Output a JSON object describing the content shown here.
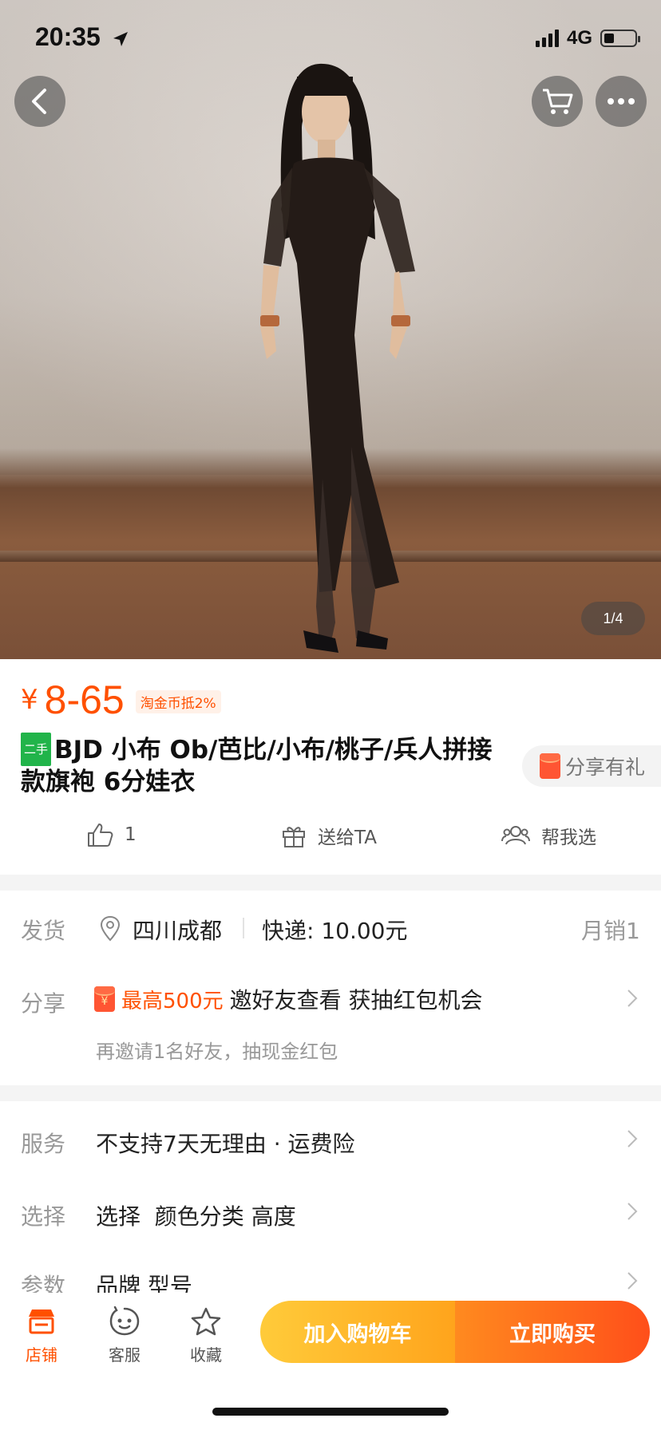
{
  "status_bar": {
    "time": "20:35",
    "network": "4G"
  },
  "gallery": {
    "page_indicator": "1/4"
  },
  "icons": {
    "back": "chevron-left-icon",
    "cart": "cart-icon",
    "more": "more-dots-icon",
    "location": "location-pin-icon",
    "like": "thumbs-up-icon",
    "gift": "gift-icon",
    "help": "people-icon",
    "store": "store-icon",
    "service": "chat-face-icon",
    "favorite": "star-icon"
  },
  "product": {
    "currency": "¥",
    "price": "8-65",
    "coin_badge": "淘金币抵2%",
    "used_tag": "二手",
    "title": "BJD 小布 Ob/芭比/小布/桃子/兵人拼接款旗袍 6分娃衣",
    "share_gift": "分享有礼"
  },
  "actions": {
    "like_count": "1",
    "gift_label": "送给TA",
    "help_label": "帮我选"
  },
  "shipping": {
    "label": "发货",
    "city": "四川成都",
    "fee": "快递: 10.00元",
    "sales": "月销1"
  },
  "share": {
    "label": "分享",
    "redpacket_symbol": "¥",
    "highlight": "最高500元",
    "text": "邀好友查看 获抽红包机会",
    "sub": "再邀请1名好友，抽现金红包"
  },
  "service": {
    "label": "服务",
    "text": "不支持7天无理由 · 运费险"
  },
  "selection": {
    "label": "选择",
    "text": "选择  颜色分类 高度"
  },
  "params": {
    "label": "参数",
    "text": "品牌 型号"
  },
  "bottom_bar": {
    "store": "店铺",
    "service": "客服",
    "favorite": "收藏",
    "add_to_cart": "加入购物车",
    "buy_now": "立即购买"
  },
  "colors": {
    "accent": "#ff5000",
    "cart_button": "#ffb12a",
    "buy_button": "#ff5a1d",
    "used_tag": "#21b44a"
  }
}
